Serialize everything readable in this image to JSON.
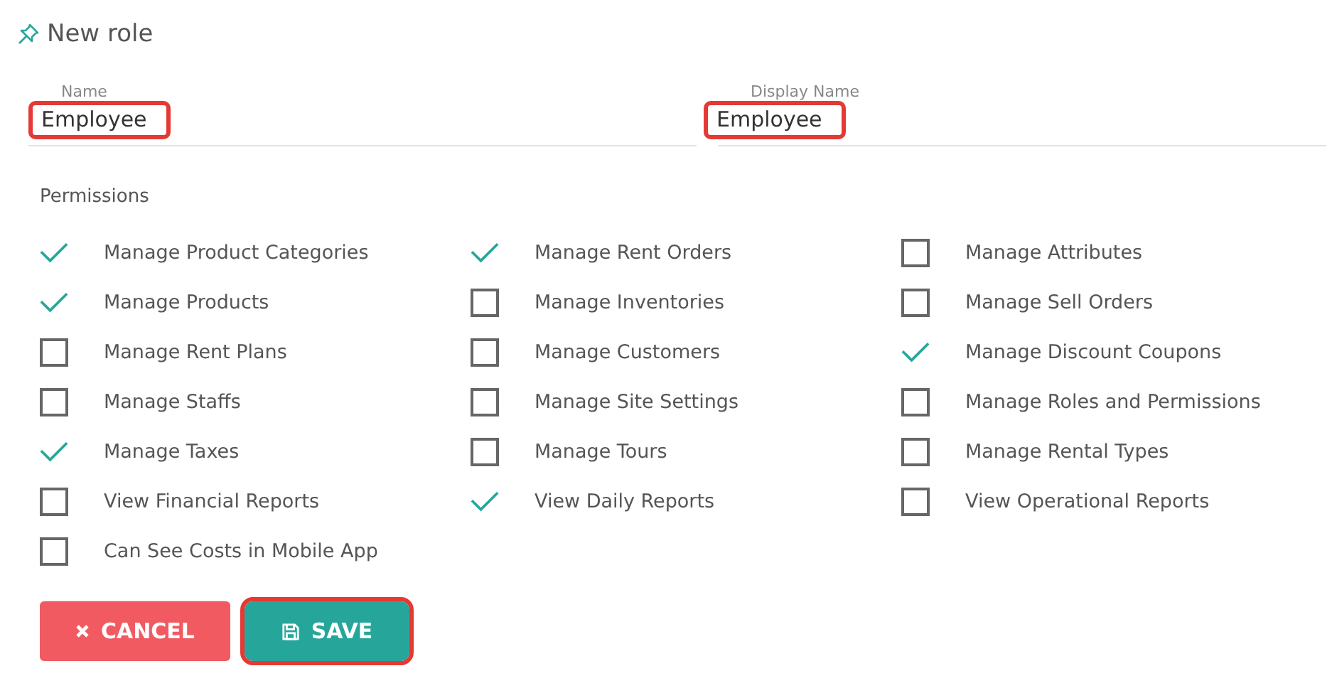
{
  "title": "New role",
  "fields": [
    {
      "label": "Name",
      "value": "Employee",
      "highlighted": true
    },
    {
      "label": "Display Name",
      "value": "Employee",
      "highlighted": true
    }
  ],
  "permissions_label": "Permissions",
  "permission_columns": [
    {
      "items": [
        {
          "label": "Manage Product Categories",
          "checked": true
        },
        {
          "label": "Manage Products",
          "checked": true
        },
        {
          "label": "Manage Rent Plans",
          "checked": false
        },
        {
          "label": "Manage Staffs",
          "checked": false
        },
        {
          "label": "Manage Taxes",
          "checked": true
        },
        {
          "label": "View Financial Reports",
          "checked": false
        },
        {
          "label": "Can See Costs in Mobile App",
          "checked": false
        }
      ]
    },
    {
      "items": [
        {
          "label": "Manage Rent Orders",
          "checked": true
        },
        {
          "label": "Manage Inventories",
          "checked": false
        },
        {
          "label": "Manage Customers",
          "checked": false
        },
        {
          "label": "Manage Site Settings",
          "checked": false
        },
        {
          "label": "Manage Tours",
          "checked": false
        },
        {
          "label": "View Daily Reports",
          "checked": true
        }
      ]
    },
    {
      "items": [
        {
          "label": "Manage Attributes",
          "checked": false
        },
        {
          "label": "Manage Sell Orders",
          "checked": false
        },
        {
          "label": "Manage Discount Coupons",
          "checked": true
        },
        {
          "label": "Manage Roles and Permissions",
          "checked": false
        },
        {
          "label": "Manage Rental Types",
          "checked": false
        },
        {
          "label": "View Operational Reports",
          "checked": false
        }
      ]
    }
  ],
  "buttons": [
    {
      "kind": "cancel",
      "label": "CANCEL",
      "highlighted": false
    },
    {
      "kind": "save",
      "label": "SAVE",
      "highlighted": true
    }
  ]
}
